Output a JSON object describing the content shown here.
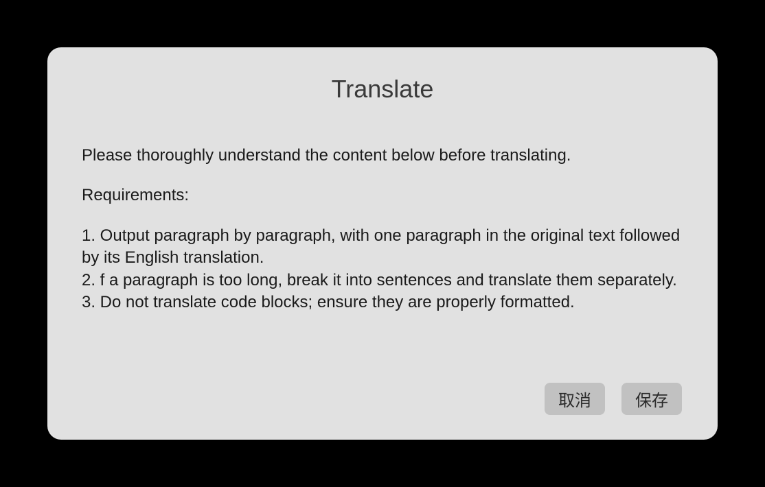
{
  "dialog": {
    "title": "Translate",
    "intro": "Please thoroughly understand the content below before translating.",
    "requirements_label": "Requirements:",
    "requirements": [
      "1. Output paragraph by paragraph, with one paragraph in the original text followed by its English translation.",
      "2. f a paragraph is too long, break it into sentences and translate them separately.",
      "3. Do not translate code blocks; ensure they are properly formatted."
    ],
    "actions": {
      "cancel": "取消",
      "save": "保存"
    }
  }
}
